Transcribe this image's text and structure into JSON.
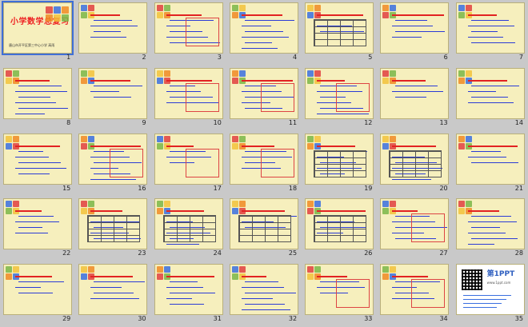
{
  "deck": {
    "cover_title": "小学数学总复习",
    "cover_subtitle": "唐山市开平区第三中心小学  高雨",
    "brand_name": "第1PPT",
    "brand_sub": "www.1ppt.com",
    "slide_numbers": [
      "1",
      "2",
      "3",
      "4",
      "5",
      "6",
      "7",
      "8",
      "9",
      "10",
      "11",
      "12",
      "13",
      "14",
      "15",
      "16",
      "17",
      "18",
      "19",
      "20",
      "21",
      "22",
      "23",
      "24",
      "25",
      "26",
      "27",
      "28",
      "29",
      "30",
      "31",
      "32",
      "33",
      "34",
      "35"
    ]
  },
  "colors": {
    "slide_bg": "#f6efbd",
    "title_red": "#e22222",
    "text_blue": "#2b3bd6",
    "accent_orange": "#f08a24",
    "accent_blue": "#3a6fe0",
    "accent_red": "#e04040"
  }
}
